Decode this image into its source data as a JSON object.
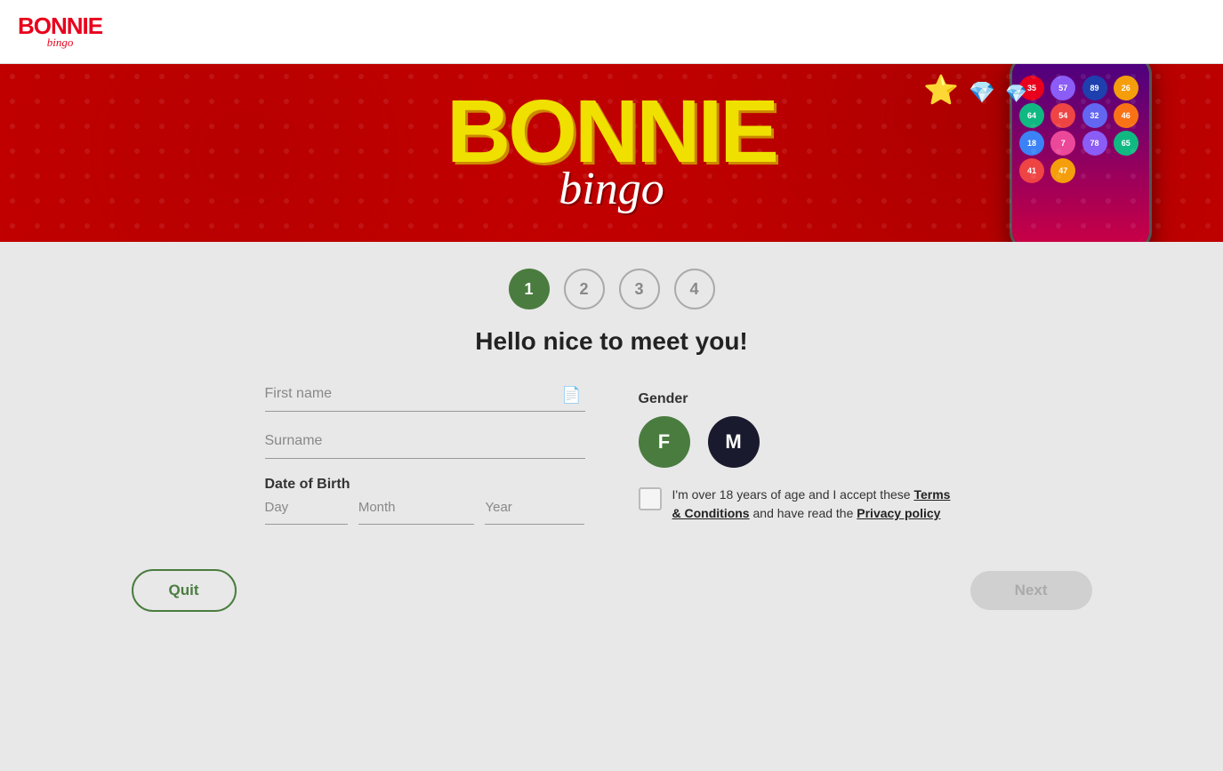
{
  "logo": {
    "main": "BONNIE",
    "sub": "bingo"
  },
  "steps": [
    {
      "number": "1",
      "active": true
    },
    {
      "number": "2",
      "active": false
    },
    {
      "number": "3",
      "active": false
    },
    {
      "number": "4",
      "active": false
    }
  ],
  "greeting": "Hello nice to meet you!",
  "form": {
    "first_name_placeholder": "First name",
    "surname_placeholder": "Surname",
    "dob_label": "Date of Birth",
    "dob_day_placeholder": "Day",
    "dob_month_placeholder": "Month",
    "dob_year_placeholder": "Year",
    "gender_label": "Gender",
    "gender_female": "F",
    "gender_male": "M",
    "terms_text_before": "I'm over 18 years of age and I accept these ",
    "terms_link1": "Terms & Conditions",
    "terms_text_mid": " and have read the ",
    "terms_link2": "Privacy policy"
  },
  "buttons": {
    "quit": "Quit",
    "next": "Next"
  },
  "bingo_balls": [
    {
      "num": "35",
      "color": "#e8001c"
    },
    {
      "num": "57",
      "color": "#8b5cf6"
    },
    {
      "num": "89",
      "color": "#1e40af"
    },
    {
      "num": "26",
      "color": "#f59e0b"
    },
    {
      "num": "64",
      "color": "#10b981"
    },
    {
      "num": "54",
      "color": "#ef4444"
    },
    {
      "num": "32",
      "color": "#6366f1"
    },
    {
      "num": "46",
      "color": "#f97316"
    },
    {
      "num": "18",
      "color": "#3b82f6"
    },
    {
      "num": "7",
      "color": "#ec4899"
    },
    {
      "num": "78",
      "color": "#8b5cf6"
    },
    {
      "num": "65",
      "color": "#10b981"
    },
    {
      "num": "41",
      "color": "#ef4444"
    },
    {
      "num": "47",
      "color": "#f59e0b"
    }
  ]
}
